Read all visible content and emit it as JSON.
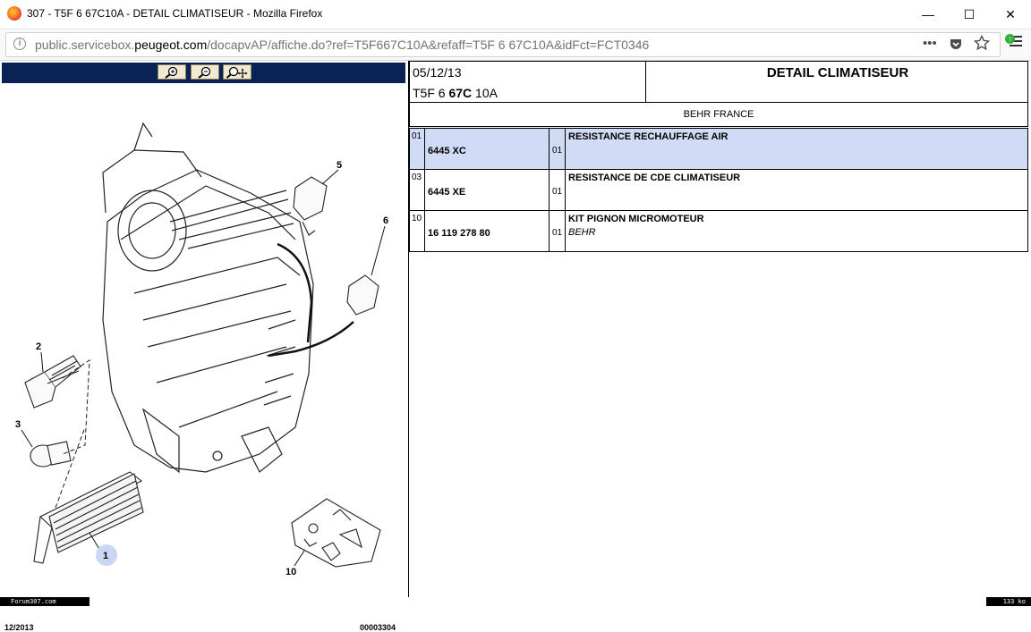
{
  "window": {
    "title": "307 - T5F 6 67C10A - DETAIL CLIMATISEUR - Mozilla Firefox",
    "minimize": "—",
    "maximize": "☐",
    "close": "✕"
  },
  "urlbar": {
    "prefix": "public.servicebox.",
    "host": "peugeot.com",
    "path": "/docapvAP/affiche.do?ref=T5F667C10A&refaff=T5F 6 67C10A&idFct=FCT0346",
    "more": "•••"
  },
  "diagram": {
    "zoom_in": "+",
    "zoom_out": "−",
    "zoom_fit": "✥",
    "callouts": [
      "1",
      "2",
      "3",
      "5",
      "6",
      "10"
    ],
    "footer_left": "12/2013",
    "footer_right": "00003304"
  },
  "header": {
    "date": "05/12/13",
    "ref_prefix": "T5F 6 ",
    "ref_bold": "67C",
    "ref_suffix": " 10A",
    "title": "DETAIL CLIMATISEUR",
    "maker": "BEHR FRANCE"
  },
  "parts": [
    {
      "index": "01",
      "ref": "6445 XC",
      "qty": "01",
      "desc": "RESISTANCE RECHAUFFAGE AIR",
      "note": ""
    },
    {
      "index": "03",
      "ref": "6445 XE",
      "qty": "01",
      "desc": "RESISTANCE DE CDE CLIMATISEUR",
      "note": ""
    },
    {
      "index": "10",
      "ref": "16 119 278 80",
      "qty": "01",
      "desc": "KIT PIGNON MICROMOTEUR",
      "note": "BEHR"
    }
  ],
  "status": {
    "left": "Forum307.com",
    "right": "133 ko"
  }
}
